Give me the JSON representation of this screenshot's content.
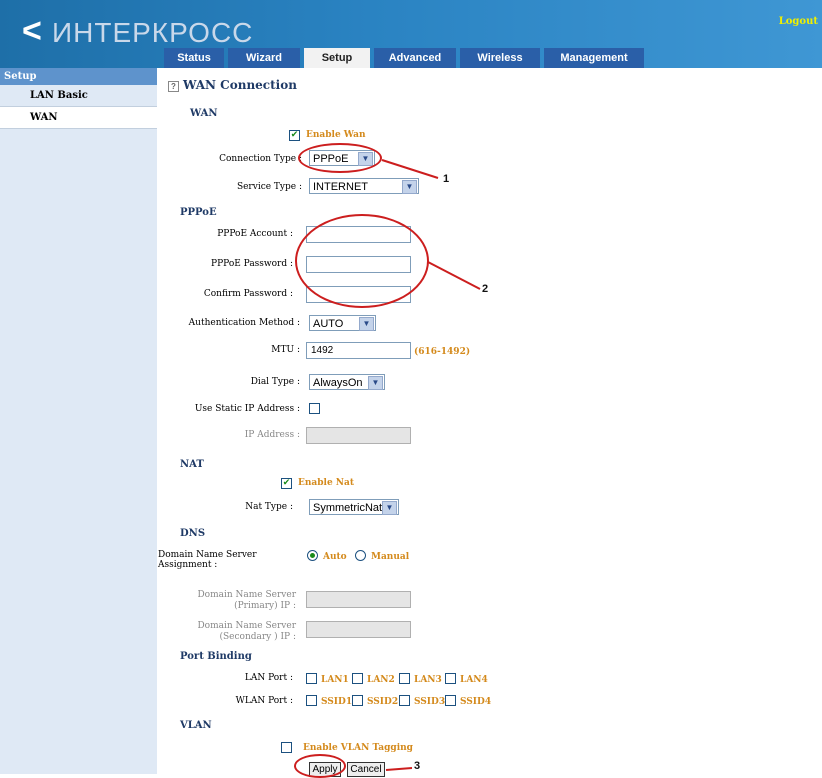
{
  "header": {
    "logo_mark": "<",
    "logo_text": "ИНТЕРКРОСС",
    "logout": "Logout"
  },
  "tabs": [
    {
      "label": "Status"
    },
    {
      "label": "Wizard"
    },
    {
      "label": "Setup"
    },
    {
      "label": "Advanced"
    },
    {
      "label": "Wireless"
    },
    {
      "label": "Management"
    }
  ],
  "sidebar": {
    "title": "Setup",
    "items": [
      {
        "label": "LAN Basic"
      },
      {
        "label": "WAN"
      }
    ]
  },
  "page": {
    "help_icon": "?",
    "title": "WAN Connection"
  },
  "wan": {
    "section": "WAN",
    "enable_label": "Enable Wan",
    "connection_type_label": "Connection Type :",
    "connection_type_value": "PPPoE",
    "service_type_label": "Service Type :",
    "service_type_value": "INTERNET"
  },
  "pppoe": {
    "section": "PPPoE",
    "account_label": "PPPoE Account :",
    "password_label": "PPPoE Password :",
    "confirm_label": "Confirm Password :",
    "auth_label": "Authentication Method :",
    "auth_value": "AUTO",
    "mtu_label": "MTU :",
    "mtu_value": "1492",
    "mtu_range": "(616-1492)",
    "dial_label": "Dial Type :",
    "dial_value": "AlwaysOn",
    "static_ip_label": "Use Static IP Address :",
    "ip_label": "IP Address :"
  },
  "nat": {
    "section": "NAT",
    "enable_label": "Enable Nat",
    "type_label": "Nat Type :",
    "type_value": "SymmetricNat"
  },
  "dns": {
    "section": "DNS",
    "assignment_label": "Domain Name Server Assignment :",
    "auto_label": "Auto",
    "manual_label": "Manual",
    "primary_label": "Domain Name Server (Primary) IP :",
    "secondary_label": "Domain Name Server (Secondary ) IP :"
  },
  "port_binding": {
    "section": "Port Binding",
    "lan_label": "LAN Port :",
    "lan_ports": [
      "LAN1",
      "LAN2",
      "LAN3",
      "LAN4"
    ],
    "wlan_label": "WLAN Port :",
    "wlan_ports": [
      "SSID1",
      "SSID2",
      "SSID3",
      "SSID4"
    ]
  },
  "vlan": {
    "section": "VLAN",
    "enable_label": "Enable VLAN Tagging"
  },
  "buttons": {
    "apply": "Apply",
    "cancel": "Cancel"
  },
  "annotations": {
    "n1": "1",
    "n2": "2",
    "n3": "3"
  },
  "colors": {
    "annotation": "#cc1e1e",
    "header": "#2a83c2",
    "tab": "#2a5fa8",
    "highlight": "#d48a1c"
  }
}
